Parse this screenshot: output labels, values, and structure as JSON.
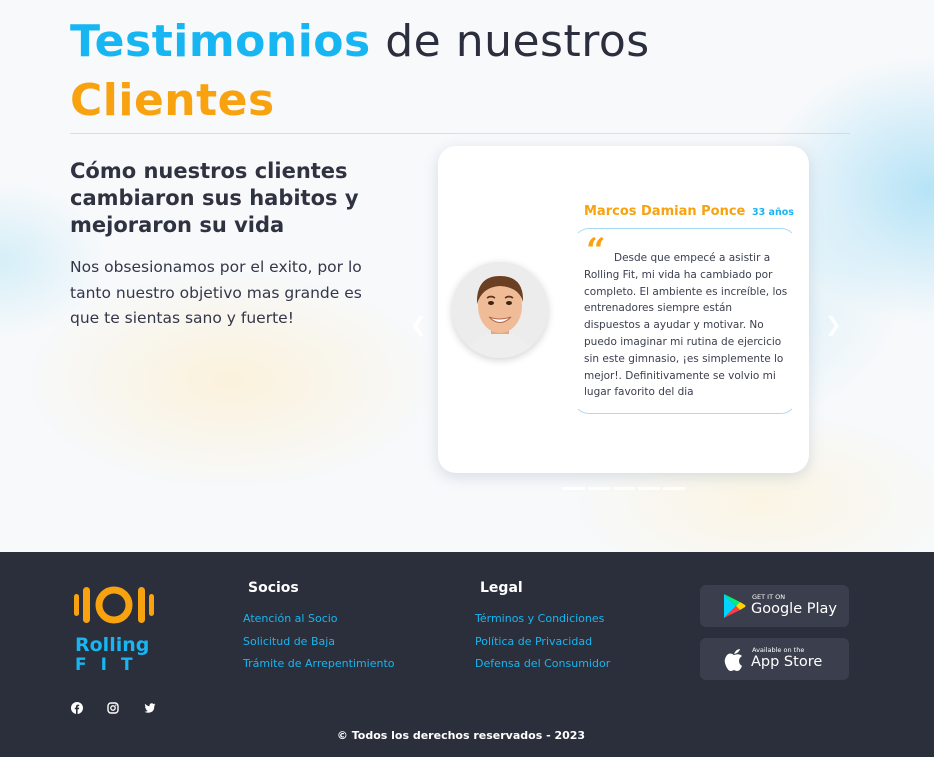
{
  "hero": {
    "title_highlight": "Testimonios",
    "title_rest": " de nuestros",
    "title_second": "Clientes",
    "subtitle": "Cómo nuestros clientes cambiaron sus habitos y mejoraron su vida",
    "description": "Nos obsesionamos por el exito, por lo tanto nuestro objetivo mas grande es que te sientas sano y fuerte!"
  },
  "carousel": {
    "prev_icon": "chevron-left-icon",
    "next_icon": "chevron-right-icon",
    "indicator_count": 5,
    "active_index": 0,
    "testimonial": {
      "name": "Marcos Damian Ponce",
      "age": "33 años",
      "quote_icon": "quote-icon",
      "text": "Desde que empecé a asistir a Rolling Fit, mi vida ha cambiado por completo. El ambiente es increíble, los entrenadores siempre están dispuestos a ayudar y motivar. No puedo imaginar mi rutina de ejercicio sin este gimnasio, ¡es simplemente lo mejor!. Definitivamente se volvio mi lugar favorito del dia"
    }
  },
  "footer": {
    "logo": {
      "line1": "Rolling",
      "line2": "FIT"
    },
    "socios": {
      "title": "Socios",
      "links": [
        "Atención al Socio",
        "Solicitud de Baja",
        "Trámite de Arrepentimiento"
      ]
    },
    "legal": {
      "title": "Legal",
      "links": [
        "Términos y Condiciones",
        "Política de Privacidad",
        "Defensa del Consumidor"
      ]
    },
    "stores": {
      "google": {
        "small": "GET IT ON",
        "big": "Google Play"
      },
      "apple": {
        "small": "Available on the",
        "big": "App Store"
      }
    },
    "social": [
      "facebook-icon",
      "instagram-icon",
      "twitter-icon"
    ],
    "copyright": "© Todos los derechos reservados - 2023"
  },
  "colors": {
    "accent_blue": "#17b6f2",
    "accent_orange": "#f8a20f",
    "footer_bg": "#2b2e3b",
    "text_dark": "#2b2e3d"
  }
}
